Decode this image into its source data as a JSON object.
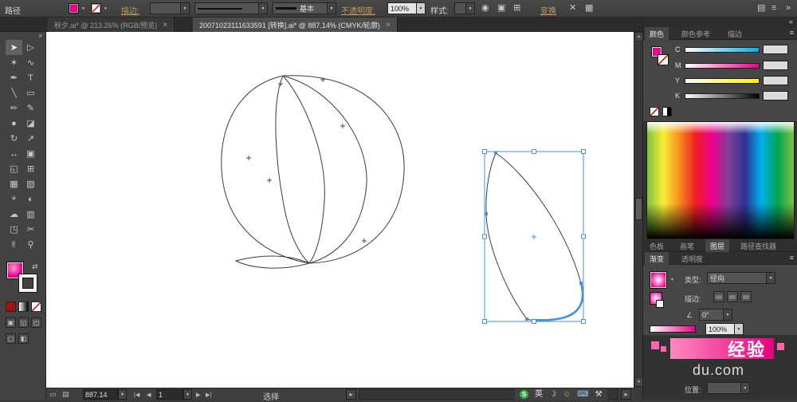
{
  "colors": {
    "accent": "#ec008c",
    "selection": "#4a90d9"
  },
  "control_bar": {
    "context_label": "路径",
    "stroke_label": "描边:",
    "brush_name": "基本",
    "opacity_label": "不透明度:",
    "opacity_value": "100%",
    "style_label": "样式:",
    "transform_label": "变换"
  },
  "document_tabs": [
    {
      "title": "秋夕.ai* @ 213.26% (RGB/预览)",
      "close": "×"
    },
    {
      "title": "20071023111633591 [转换].ai* @ 887.14% (CMYK/轮廓)",
      "close": "×"
    }
  ],
  "tools": [
    {
      "name": "selection",
      "glyph": "➤"
    },
    {
      "name": "direct-selection",
      "glyph": "▷"
    },
    {
      "name": "magic-wand",
      "glyph": "✶"
    },
    {
      "name": "lasso",
      "glyph": "∿"
    },
    {
      "name": "pen",
      "glyph": "✒"
    },
    {
      "name": "type",
      "glyph": "T"
    },
    {
      "name": "line-segment",
      "glyph": "╲"
    },
    {
      "name": "rectangle",
      "glyph": "▭"
    },
    {
      "name": "paintbrush",
      "glyph": "✏"
    },
    {
      "name": "pencil",
      "glyph": "✎"
    },
    {
      "name": "blob-brush",
      "glyph": "●"
    },
    {
      "name": "eraser",
      "glyph": "◪"
    },
    {
      "name": "rotate",
      "glyph": "↻"
    },
    {
      "name": "scale",
      "glyph": "↗"
    },
    {
      "name": "width",
      "glyph": "↔"
    },
    {
      "name": "free-transform",
      "glyph": "▣"
    },
    {
      "name": "shape-builder",
      "glyph": "◱"
    },
    {
      "name": "perspective-grid",
      "glyph": "⊞"
    },
    {
      "name": "mesh",
      "glyph": "▦"
    },
    {
      "name": "gradient",
      "glyph": "▧"
    },
    {
      "name": "eyedropper",
      "glyph": "⌖"
    },
    {
      "name": "blend",
      "glyph": "◐"
    },
    {
      "name": "symbol-sprayer",
      "glyph": "☁"
    },
    {
      "name": "column-graph",
      "glyph": "▥"
    },
    {
      "name": "artboard",
      "glyph": "◳"
    },
    {
      "name": "slice",
      "glyph": "✂"
    },
    {
      "name": "hand",
      "glyph": "✌"
    },
    {
      "name": "zoom",
      "glyph": "⚲"
    }
  ],
  "icons": {
    "dropdown": "▼",
    "collapse_left": "«",
    "collapse_right": "»",
    "panel_menu": "≡",
    "recolor": "◉",
    "doc_setup": "▣",
    "align": "⊞",
    "shear": "✕",
    "distribute": "▦",
    "swap": "⇄",
    "scroll_up": "▲",
    "scroll_down": "▼",
    "scroll_right": "▶",
    "nav_first": "|◀",
    "nav_prev": "◀",
    "nav_next": "▶",
    "nav_last": "▶|",
    "angle": "∠",
    "moon": "☽",
    "smiley": "☺",
    "keyboard": "⌨",
    "wrench": "⚒",
    "status_a": "▭",
    "status_b": "▤"
  },
  "color_panel": {
    "tabs": [
      "颜色",
      "颜色参考",
      "描边"
    ],
    "channels": [
      {
        "label": "C"
      },
      {
        "label": "M"
      },
      {
        "label": "Y"
      },
      {
        "label": "K"
      }
    ]
  },
  "dock_tabs": [
    "色板",
    "画笔",
    "图层",
    "路径查找器"
  ],
  "gradient_panel": {
    "tabs": [
      "渐变",
      "透明度"
    ],
    "type_label": "类型:",
    "type_value": "径向",
    "stroke_label": "描边:",
    "angle_value": "0°",
    "opacity_value": "100%",
    "location_label": "位置:"
  },
  "status_bar": {
    "zoom": "887.14",
    "artboard": "1",
    "status": "选择"
  },
  "ime_bar": {
    "logo": "S",
    "lang": "英"
  },
  "watermark": {
    "title": "经验",
    "domain": "du.com"
  }
}
